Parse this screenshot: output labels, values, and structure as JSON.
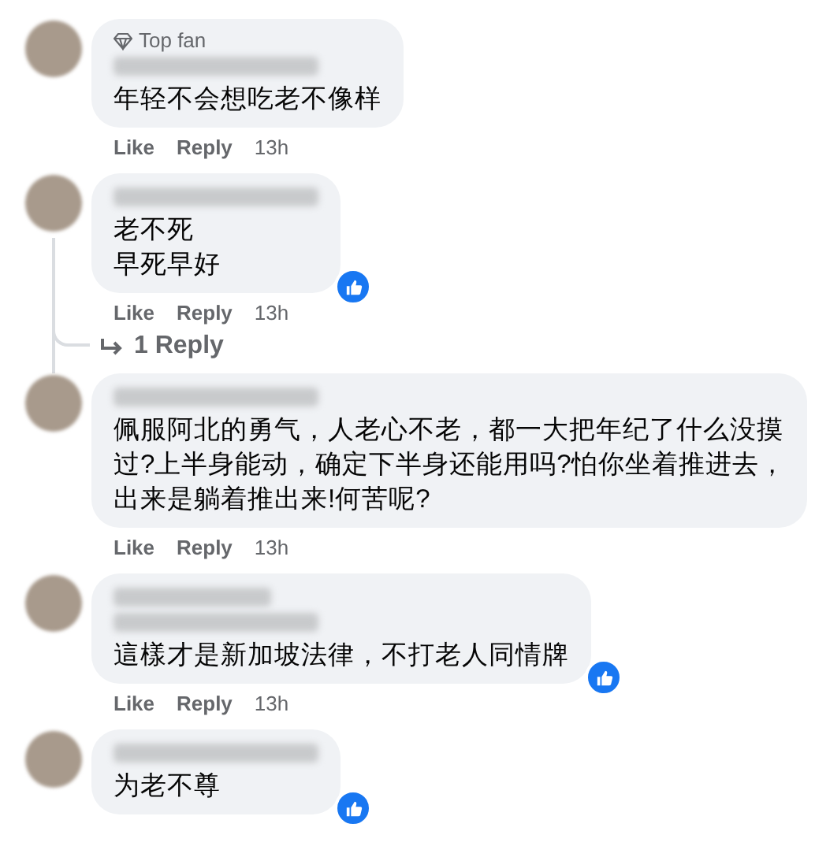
{
  "comments": [
    {
      "badge": {
        "kind": "top_fan",
        "label": "Top fan"
      },
      "lines": [
        "年轻不会想吃老不像样"
      ],
      "actions": {
        "like": "Like",
        "reply": "Reply",
        "time": "13h"
      }
    },
    {
      "lines": [
        "老不死",
        "早死早好"
      ],
      "reaction": true,
      "actions": {
        "like": "Like",
        "reply": "Reply",
        "time": "13h"
      },
      "replies_link": {
        "label": "1 Reply"
      }
    },
    {
      "lines": [
        "佩服阿北的勇气，人老心不老，都一大把年纪了什么没摸",
        "过?上半身能动，确定下半身还能用吗?怕你坐着推进去，",
        "出来是躺着推出来!何苦呢?"
      ],
      "actions": {
        "like": "Like",
        "reply": "Reply",
        "time": "13h"
      }
    },
    {
      "badge_obscured": true,
      "lines": [
        "這樣才是新加坡法律，不打老人同情牌"
      ],
      "reaction": true,
      "actions": {
        "like": "Like",
        "reply": "Reply",
        "time": "13h"
      }
    },
    {
      "lines": [
        "为老不尊"
      ],
      "reaction": true
    }
  ]
}
